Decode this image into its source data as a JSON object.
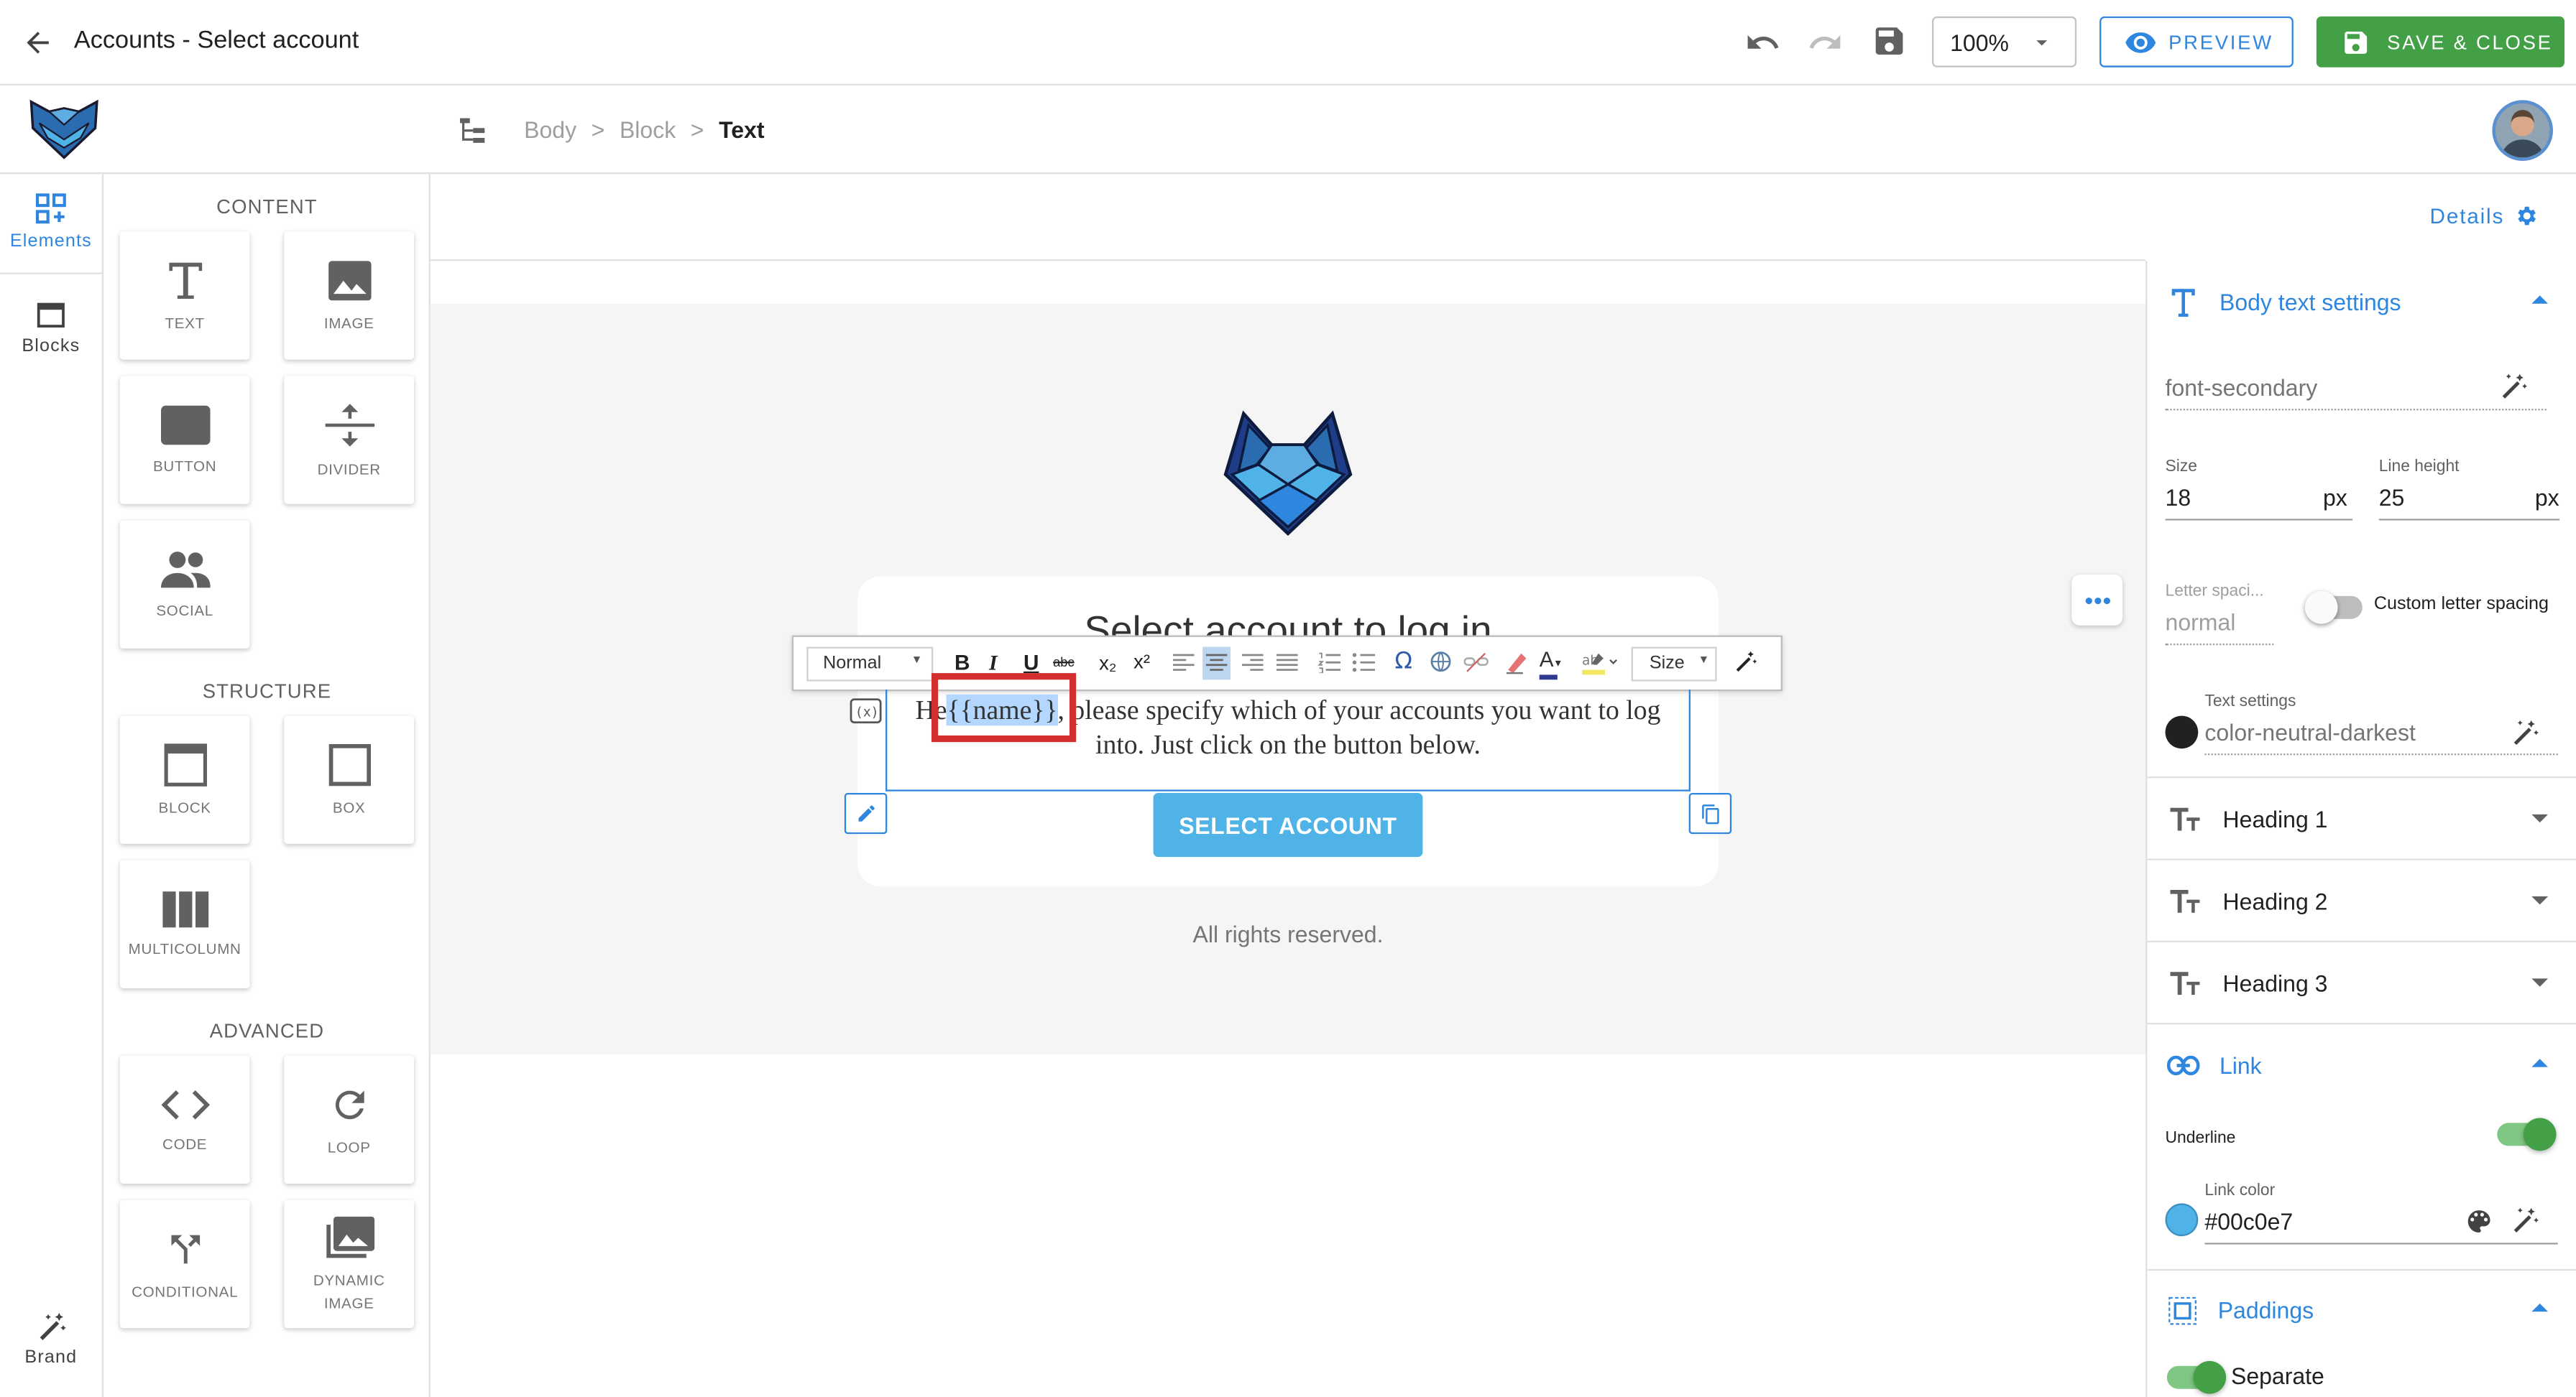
{
  "topbar": {
    "title": "Accounts - Select account",
    "zoom": "100%",
    "preview_label": "PREVIEW",
    "save_close_label": "SAVE & CLOSE"
  },
  "breadcrumb": [
    "Body",
    ">",
    "Block",
    ">",
    "Text"
  ],
  "rail": {
    "elements_label": "Elements",
    "blocks_label": "Blocks",
    "brand_label": "Brand"
  },
  "palette": {
    "content_title": "CONTENT",
    "structure_title": "STRUCTURE",
    "advanced_title": "ADVANCED",
    "text": "TEXT",
    "image": "IMAGE",
    "button": "BUTTON",
    "divider": "DIVIDER",
    "social": "SOCIAL",
    "block": "BLOCK",
    "box": "BOX",
    "multicolumn": "MULTICOLUMN",
    "code": "CODE",
    "loop": "LOOP",
    "conditional": "CONDITIONAL",
    "dynamic_image_1": "DYNAMIC",
    "dynamic_image_2": "IMAGE"
  },
  "canvas": {
    "details_label": "Details",
    "heading": "Select account to log in",
    "body_pre": "He",
    "body_var": "{{name}}",
    "body_post": ", please specify which of your accounts you want to log",
    "body_line2": "into. Just click on the button below.",
    "button_label": "SELECT ACCOUNT",
    "footer": "All rights reserved."
  },
  "editor_toolbar": {
    "format": "Normal",
    "size": "Size",
    "bold": "B",
    "italic": "I",
    "underline": "U",
    "strike": "abc",
    "sub": "x₂",
    "sup": "x²",
    "omega": "Ω"
  },
  "panel": {
    "body_text_title": "Body text settings",
    "font": "font-secondary",
    "size_label": "Size",
    "size_value": "18",
    "size_unit": "px",
    "lh_label": "Line height",
    "lh_value": "25",
    "lh_unit": "px",
    "ls_label": "Letter spaci...",
    "ls_value": "normal",
    "custom_ls_label": "Custom letter spacing",
    "text_settings_label": "Text settings",
    "text_color": "color-neutral-darkest",
    "h1": "Heading 1",
    "h2": "Heading 2",
    "h3": "Heading 3",
    "link_title": "Link",
    "underline_label": "Underline",
    "link_color_label": "Link color",
    "link_color_value": "#00c0e7",
    "paddings_title": "Paddings",
    "separate_label": "Separate"
  },
  "colors": {
    "accent": "#2e86de",
    "save": "#43a047",
    "button": "#4fb3e8",
    "link": "#4fb3e8",
    "toggle_on": "#43a047",
    "highlight": "#d32f2f"
  }
}
